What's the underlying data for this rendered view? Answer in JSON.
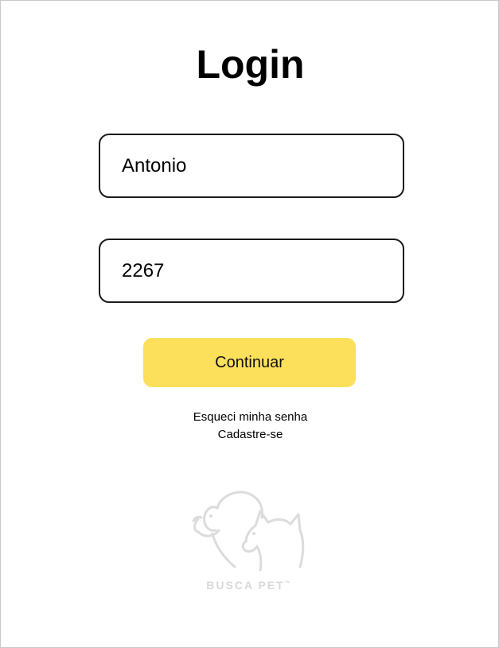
{
  "page": {
    "title": "Login"
  },
  "form": {
    "username_value": "Antonio",
    "password_value": "2267",
    "continue_label": "Continuar"
  },
  "links": {
    "forgot_password": "Esqueci minha senha",
    "register": "Cadastre-se"
  },
  "brand": {
    "name": "BUSCA PET",
    "trademark": "™",
    "logo_icon": "dog-and-cat-outline-icon",
    "logo_color": "#dcdcdc"
  },
  "colors": {
    "accent": "#fce05b",
    "field_border": "#1a1a1a",
    "frame_border": "#c8c8c8"
  }
}
